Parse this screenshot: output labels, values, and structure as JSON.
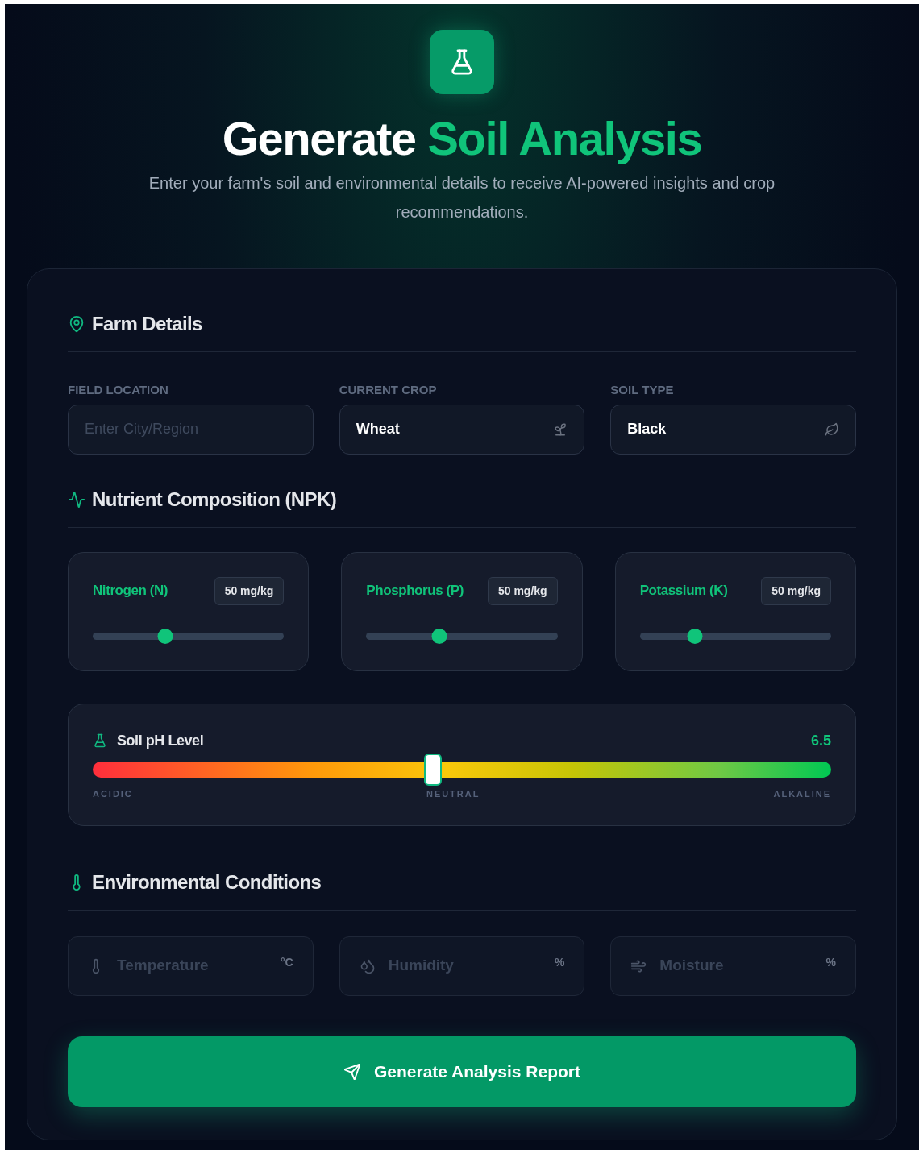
{
  "header": {
    "title_plain": "Generate",
    "title_accent": "Soil Analysis",
    "subtitle": "Enter your farm's soil and environmental details to receive AI-powered insights and crop recommendations."
  },
  "farm_details": {
    "heading": "Farm Details",
    "fields": [
      {
        "label": "FIELD LOCATION",
        "placeholder": "Enter City/Region",
        "kind": "text"
      },
      {
        "label": "CURRENT CROP",
        "value": "Wheat",
        "kind": "sprout"
      },
      {
        "label": "SOIL TYPE",
        "value": "Black",
        "kind": "leaf"
      }
    ]
  },
  "nutrients": {
    "heading": "Nutrient Composition (NPK)",
    "items": [
      {
        "name": "Nitrogen (N)",
        "reading": "50 mg/kg",
        "level": 0.37
      },
      {
        "name": "Phosphorus (P)",
        "reading": "50 mg/kg",
        "level": 0.37
      },
      {
        "name": "Potassium (K)",
        "reading": "50 mg/kg",
        "level": 0.27
      }
    ]
  },
  "ph": {
    "label": "Soil pH Level",
    "reading": "6.5",
    "level": 0.46,
    "scale": [
      "ACIDIC",
      "NEUTRAL",
      "ALKALINE"
    ]
  },
  "environment": {
    "heading": "Environmental Conditions",
    "fields": [
      {
        "placeholder": "Temperature",
        "unit": "°C",
        "kind": "temperature"
      },
      {
        "placeholder": "Humidity",
        "unit": "%",
        "kind": "humidity"
      },
      {
        "placeholder": "Moisture",
        "unit": "%",
        "kind": "moisture"
      }
    ]
  },
  "submit": {
    "label": "Generate Analysis Report"
  }
}
